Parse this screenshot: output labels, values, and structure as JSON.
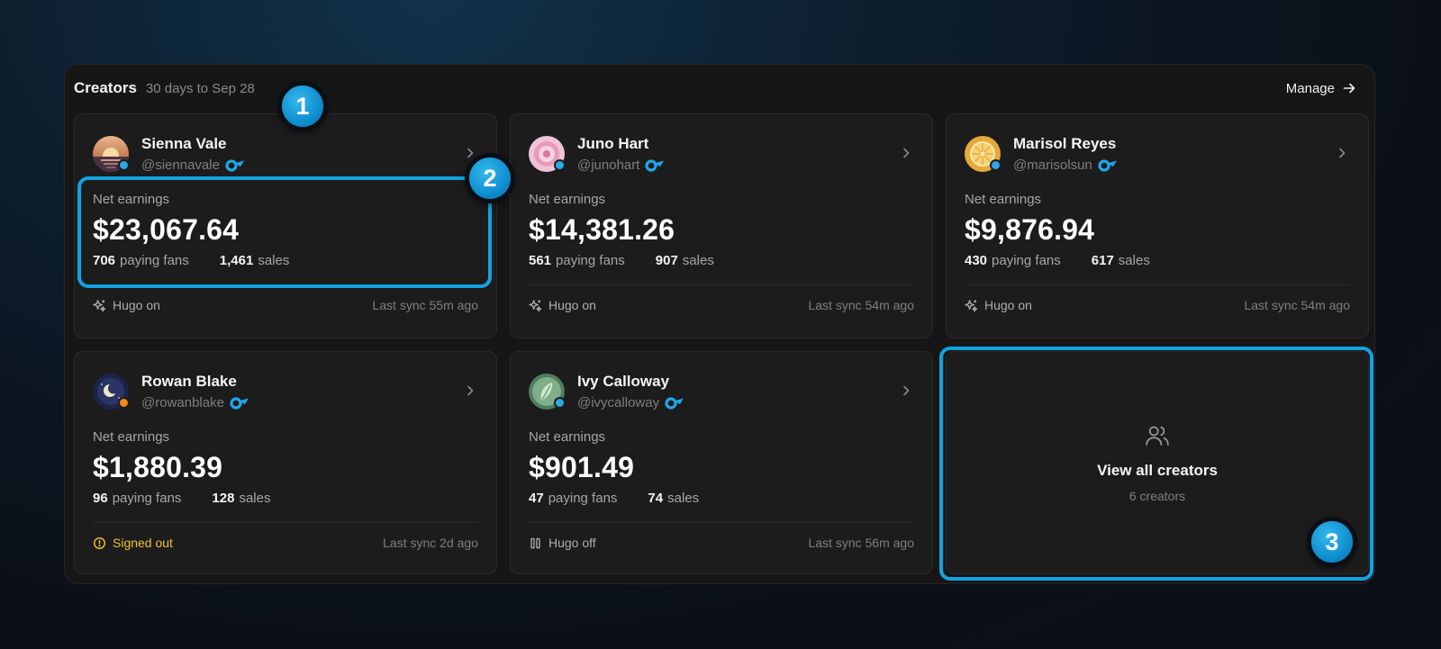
{
  "header": {
    "title": "Creators",
    "range": "30 days to Sep 28",
    "manage_label": "Manage"
  },
  "labels": {
    "net_earnings": "Net earnings",
    "paying_fans": "paying fans",
    "sales": "sales"
  },
  "creators": [
    {
      "name": "Sienna Vale",
      "handle": "@siennavale",
      "earnings": "$23,067.64",
      "fans": "706",
      "sales": "1,461",
      "status_text": "Hugo on",
      "sync": "Last sync 55m ago",
      "dot_color": "#2fa8e8"
    },
    {
      "name": "Juno Hart",
      "handle": "@junohart",
      "earnings": "$14,381.26",
      "fans": "561",
      "sales": "907",
      "status_text": "Hugo on",
      "sync": "Last sync 54m ago",
      "dot_color": "#2fa8e8"
    },
    {
      "name": "Marisol Reyes",
      "handle": "@marisolsun",
      "earnings": "$9,876.94",
      "fans": "430",
      "sales": "617",
      "status_text": "Hugo on",
      "sync": "Last sync 54m ago",
      "dot_color": "#2fa8e8"
    },
    {
      "name": "Rowan Blake",
      "handle": "@rowanblake",
      "earnings": "$1,880.39",
      "fans": "96",
      "sales": "128",
      "status_text": "Signed out",
      "sync": "Last sync 2d ago",
      "dot_color": "#f08a1c"
    },
    {
      "name": "Ivy Calloway",
      "handle": "@ivycalloway",
      "earnings": "$901.49",
      "fans": "47",
      "sales": "74",
      "status_text": "Hugo off",
      "sync": "Last sync 56m ago",
      "dot_color": "#2fa8e8"
    }
  ],
  "view_all": {
    "title": "View all creators",
    "count": "6 creators"
  },
  "badges": [
    "1",
    "2",
    "3"
  ],
  "colors": {
    "accent": "#12a2e0",
    "warning": "#f2c230",
    "platform": "#1ea7ea"
  },
  "icons": {
    "manage": "arrow-right-icon",
    "chevron": "chevron-right-icon",
    "platform": "platform-logo-icon",
    "hugo_on": "sparkle-icon",
    "hugo_off": "pause-icon",
    "signed_out": "alert-circle-icon",
    "view_all": "users-icon"
  }
}
